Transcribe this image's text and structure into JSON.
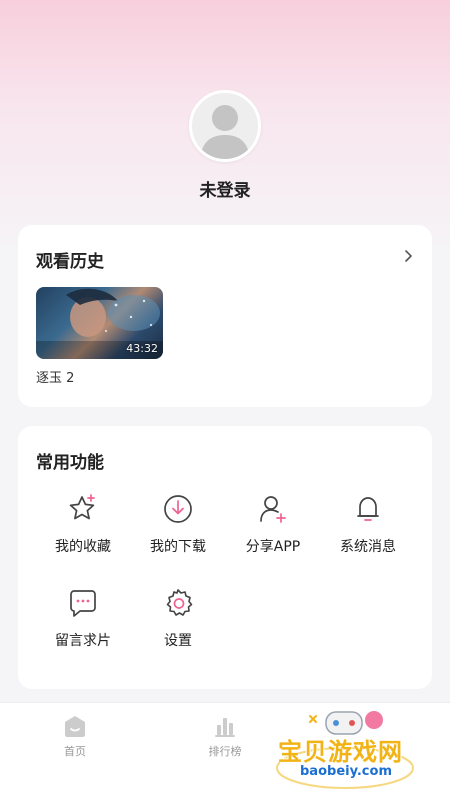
{
  "profile": {
    "login_status": "未登录",
    "avatar_icon": "default-user-avatar-icon"
  },
  "history": {
    "title": "观看历史",
    "more_icon": "chevron-right-icon",
    "items": [
      {
        "title": "逐玉 2",
        "duration": "43:32"
      }
    ]
  },
  "functions": {
    "title": "常用功能",
    "items": [
      {
        "label": "我的收藏",
        "icon": "star-add-icon"
      },
      {
        "label": "我的下载",
        "icon": "download-icon"
      },
      {
        "label": "分享APP",
        "icon": "share-user-icon"
      },
      {
        "label": "系统消息",
        "icon": "bell-icon"
      },
      {
        "label": "留言求片",
        "icon": "message-icon"
      },
      {
        "label": "设置",
        "icon": "gear-icon"
      }
    ]
  },
  "tabbar": {
    "items": [
      {
        "label": "首页",
        "icon": "home-icon"
      },
      {
        "label": "排行榜",
        "icon": "ranking-icon"
      }
    ]
  },
  "watermark": {
    "logo_text": "宝贝游戏网",
    "domain": "baobeiy.com"
  },
  "colors": {
    "accent_pink": "#f06292",
    "header_pink": "#f7cfdc",
    "text_dark": "#222222",
    "tab_inactive": "#999999"
  }
}
